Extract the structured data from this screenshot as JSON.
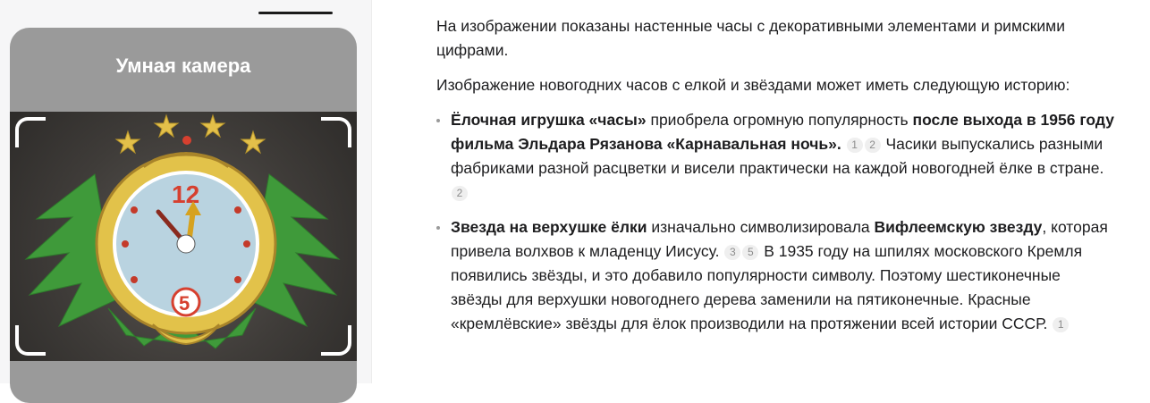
{
  "camera": {
    "title": "Умная камера"
  },
  "intro": "На изображении показаны настенные часы с декоративными элементами и римскими цифрами.",
  "lead": "Изображение новогодних часов с елкой и звёздами может иметь следующую историю:",
  "items": [
    {
      "b1": "Ёлочная игрушка «часы»",
      "t1": " приобрела огромную популярность ",
      "b2": "после выхода в 1956 году фильма Эльдара Рязанова «Карнавальная ночь».",
      "c1": "1",
      "c2": "2",
      "t2": " Часики выпускались разными фабриками разной расцветки и висели практически на каждой новогодней ёлке в стране.",
      "c3": "2"
    },
    {
      "b1": "Звезда на верхушке ёлки",
      "t1": " изначально символизировала ",
      "b2": "Вифлеемскую звезду",
      "t2": ", которая привела волхвов к младенцу Иисусу.",
      "c1": "3",
      "c2": "5",
      "t3": " В 1935 году на шпилях московского Кремля появились звёзды, и это добавило популярности символу. Поэтому шестиконечные звёзды для верхушки новогоднего дерева заменили на пятиконечные. Красные «кремлёвские» звёзды для ёлок производили на протяжении всей истории СССР.",
      "c3": "1"
    }
  ],
  "colors": {
    "card_bg": "#9a9a9a",
    "clock_face": "#b9d3e0",
    "clock_frame": "#e2c24a",
    "fir": "#3f9a3a",
    "star": "#e3c04a",
    "accent_red": "#d6402f"
  }
}
